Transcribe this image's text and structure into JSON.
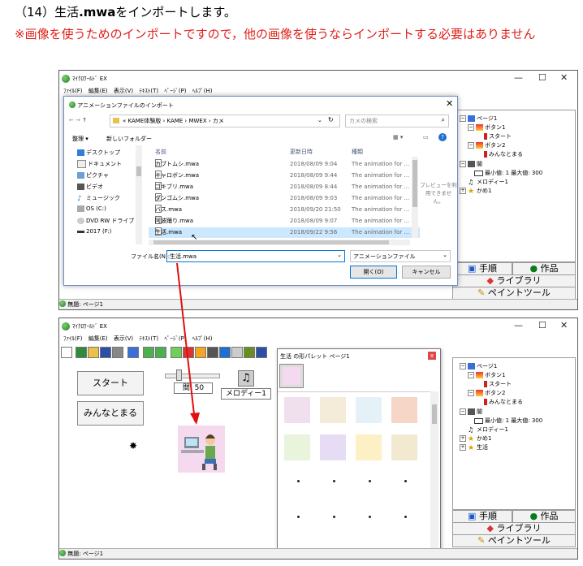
{
  "doc": {
    "heading_prefix": "（14）生活",
    "heading_ext": ".mwa",
    "heading_suffix": "をインポートします。",
    "note": "※画像を使うためのインポートですので，他の画像を使うならインポートする必要はありません"
  },
  "app": {
    "title": "ﾏｲｸﾛﾜｰﾙﾄﾞ EX",
    "controls": {
      "min": "—",
      "max": "☐",
      "close": "✕"
    },
    "menu": [
      "ﾌｧｲﾙ(F)",
      "編集(E)",
      "表示(V)",
      "ﾃｷｽﾄ(T)",
      "ﾍﾟｰｼﾞ(P)",
      "ﾍﾙﾌﾟ(H)"
    ],
    "status": "無題: ページ1",
    "tabs": {
      "procedure": "手順",
      "works": "作品",
      "library": "ライブラリ",
      "paint": "ペイントツール"
    }
  },
  "tree1": [
    "ページ1",
    "ボタン1",
    "スタート",
    "ボタン2",
    "みんなとまる",
    "闇",
    "最小値: 1 最大値: 300",
    "メロディー1",
    "かめ1"
  ],
  "tree2": [
    "ページ1",
    "ボタン1",
    "スタート",
    "ボタン2",
    "みんなとまる",
    "闇",
    "最小値: 1 最大値: 300",
    "メロディー1",
    "かめ1",
    "生活"
  ],
  "dialog": {
    "title": "アニメーションファイルのインポート",
    "path": [
      "« KAME体験版",
      "KAME",
      "MWEX",
      "カメ"
    ],
    "search_placeholder": "カメの検索",
    "organize": "整理 ▾",
    "new_folder": "新しいフォルダー",
    "nav": [
      "デスクトップ",
      "ドキュメント",
      "ピクチャ",
      "ビデオ",
      "ミュージック",
      "OS (C:)",
      "DVD RW ドライブ (",
      "2017 (F:)"
    ],
    "columns": {
      "name": "名前",
      "date": "更新日時",
      "type": "種類"
    },
    "files": [
      {
        "name": "カブトムシ.mwa",
        "date": "2018/08/09 9:04",
        "type": "The animation for ..."
      },
      {
        "name": "キャロボン.mwa",
        "date": "2018/08/09 9:44",
        "type": "The animation for ..."
      },
      {
        "name": "ゴキブリ.mwa",
        "date": "2018/08/09 8:44",
        "type": "The animation for ..."
      },
      {
        "name": "ダンゴムシ.mwa",
        "date": "2018/08/09 9:03",
        "type": "The animation for ..."
      },
      {
        "name": "バス.mwa",
        "date": "2018/09/20 21:50",
        "type": "The animation for ..."
      },
      {
        "name": "阿波踊り.mwa",
        "date": "2018/08/09 9:07",
        "type": "The animation for ..."
      },
      {
        "name": "生活.mwa",
        "date": "2018/09/22 9:56",
        "type": "The animation for ..."
      }
    ],
    "preview": [
      "プレビューを利",
      "用できませ",
      "ん。"
    ],
    "filename_label": "ファイル名(N):",
    "filename_value": "生活.mwa",
    "filter": "アニメーションファイル",
    "open": "開く(O)",
    "cancel": "キャンセル"
  },
  "canvas": {
    "start_button": "スタート",
    "stop_button": "みんなとまる",
    "slider_label": "間",
    "slider_value": "50",
    "melody_label": "メロディー1"
  },
  "palette": {
    "title": "生活 の形パレット ページ1"
  },
  "colors": {
    "note_red": "#e0201a",
    "selection": "#cce8ff",
    "arrow": "#e01010",
    "dialog_border": "#6a8fc6"
  }
}
